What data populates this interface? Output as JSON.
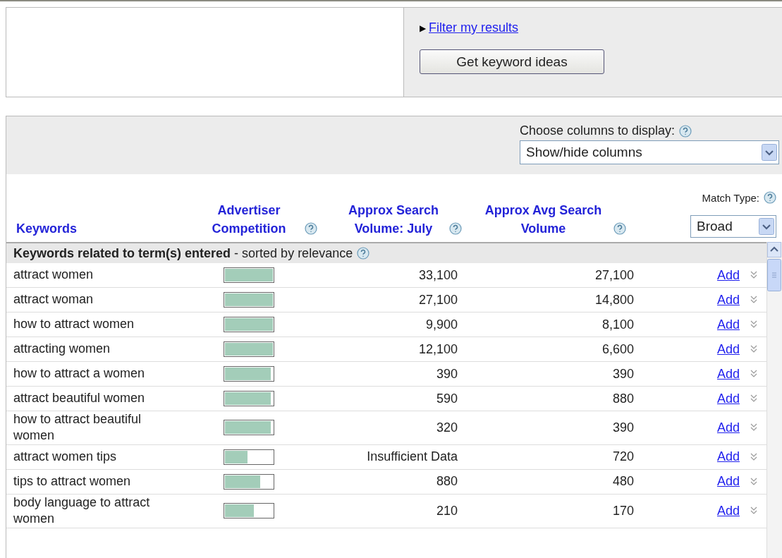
{
  "filter_link": {
    "arrow": "▶",
    "label": "Filter my results"
  },
  "get_ideas_button": "Get keyword ideas",
  "columns_chooser": {
    "label": "Choose columns to display:",
    "value": "Show/hide columns"
  },
  "match_type": {
    "label": "Match Type:",
    "value": "Broad"
  },
  "table": {
    "columns": [
      {
        "label": "Keywords",
        "help": false
      },
      {
        "label": "Advertiser Competition",
        "help": true
      },
      {
        "label": "Approx Search Volume: July",
        "help": true
      },
      {
        "label": "Approx Avg Search Volume",
        "help": true
      }
    ],
    "group": {
      "title": "Keywords related to term(s) entered",
      "note": " - sorted by relevance"
    },
    "rows": [
      {
        "keyword": "attract women",
        "level": 1,
        "july": "33,100",
        "avg": "27,100",
        "action": "Add"
      },
      {
        "keyword": "attract woman",
        "level": 1,
        "july": "27,100",
        "avg": "14,800",
        "action": "Add"
      },
      {
        "keyword": "how to attract women",
        "level": 1,
        "july": "9,900",
        "avg": "8,100",
        "action": "Add"
      },
      {
        "keyword": "attracting women",
        "level": 1,
        "july": "12,100",
        "avg": "6,600",
        "action": "Add"
      },
      {
        "keyword": "how to attract a women",
        "level": 0.95,
        "july": "390",
        "avg": "390",
        "action": "Add"
      },
      {
        "keyword": "attract beautiful women",
        "level": 0.95,
        "july": "590",
        "avg": "880",
        "action": "Add"
      },
      {
        "keyword": "how to attract beautiful women",
        "level": 0.95,
        "july": "320",
        "avg": "390",
        "action": "Add"
      },
      {
        "keyword": "attract women tips",
        "level": 0.47,
        "july": "Insufficient Data",
        "avg": "720",
        "action": "Add"
      },
      {
        "keyword": "tips to attract women",
        "level": 0.73,
        "july": "880",
        "avg": "480",
        "action": "Add"
      },
      {
        "keyword": "body language to attract women",
        "level": 0.6,
        "july": "210",
        "avg": "170",
        "action": "Add"
      }
    ]
  }
}
